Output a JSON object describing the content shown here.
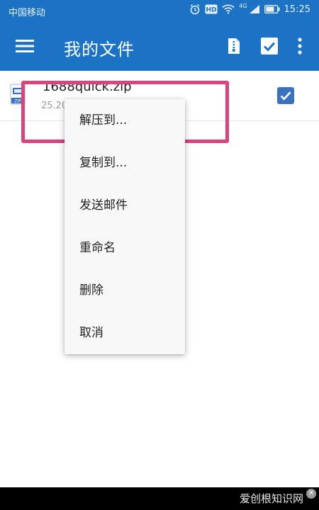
{
  "status_bar": {
    "carrier": "中国移动",
    "network": "4G",
    "time": "15:25",
    "icons": [
      "alarm-icon",
      "hd-icon",
      "wifi-icon",
      "signal-icon",
      "battery-icon"
    ]
  },
  "app_bar": {
    "title": "我的文件",
    "actions": [
      "menu-icon",
      "zip-file-icon",
      "select-check-icon",
      "more-vert-icon"
    ]
  },
  "file": {
    "name": "1688quick.zip",
    "size": "25.20",
    "checked": true
  },
  "context_menu": {
    "items": [
      {
        "label": "解压到..."
      },
      {
        "label": "复制到..."
      },
      {
        "label": "发送邮件"
      },
      {
        "label": "重命名"
      },
      {
        "label": "删除"
      },
      {
        "label": "取消"
      }
    ]
  },
  "watermark": {
    "text": "爱创根知识网"
  },
  "colors": {
    "app_bar": "#1c73c5",
    "checkbox": "#3a71c1",
    "highlight": "#d9447d"
  }
}
